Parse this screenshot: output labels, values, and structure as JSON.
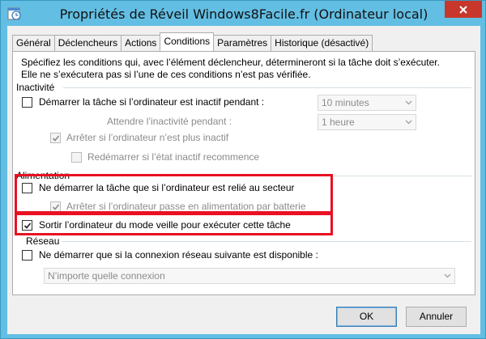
{
  "window": {
    "title": "Propriétés de Réveil Windows8Facile.fr (Ordinateur local)"
  },
  "tabs": [
    {
      "label": "Général"
    },
    {
      "label": "Déclencheurs"
    },
    {
      "label": "Actions"
    },
    {
      "label": "Conditions"
    },
    {
      "label": "Paramètres"
    },
    {
      "label": "Historique (désactivé)"
    }
  ],
  "intro": {
    "line1": "Spécifiez les conditions qui, avec l’élément déclencheur, détermineront si la tâche doit s’exécuter.",
    "line2": "Elle ne s’exécutera pas si l’une de ces conditions n’est pas vérifiée."
  },
  "inactivity": {
    "group_label": "Inactivité",
    "start_idle_label": "Démarrer la tâche si l’ordinateur est inactif pendant :",
    "start_idle_checked": false,
    "idle_duration_value": "10 minutes",
    "wait_label": "Attendre l’inactivité pendant :",
    "wait_value": "1 heure",
    "stop_label": "Arrêter si l’ordinateur n’est plus inactif",
    "stop_checked": true,
    "restart_label": "Redémarrer si l’état inactif recommence",
    "restart_checked": false
  },
  "power": {
    "group_label": "Alimentation",
    "ac_only_label": "Ne démarrer la tâche que si l’ordinateur est relié au secteur",
    "ac_only_checked": false,
    "battery_stop_label": "Arrêter si l’ordinateur passe en alimentation par batterie",
    "battery_stop_checked": true,
    "wake_label": "Sortir l’ordinateur du mode veille pour exécuter cette tâche",
    "wake_checked": true
  },
  "network": {
    "group_label": "Réseau",
    "network_only_label": "Ne démarrer que si la connexion réseau suivante est disponible :",
    "network_only_checked": false,
    "connection_value": "N’importe quelle connexion"
  },
  "buttons": {
    "ok": "OK",
    "cancel": "Annuler"
  },
  "colors": {
    "title_bar": "#63bee3",
    "close_button": "#c7372b",
    "highlight_box": "#e81123"
  }
}
